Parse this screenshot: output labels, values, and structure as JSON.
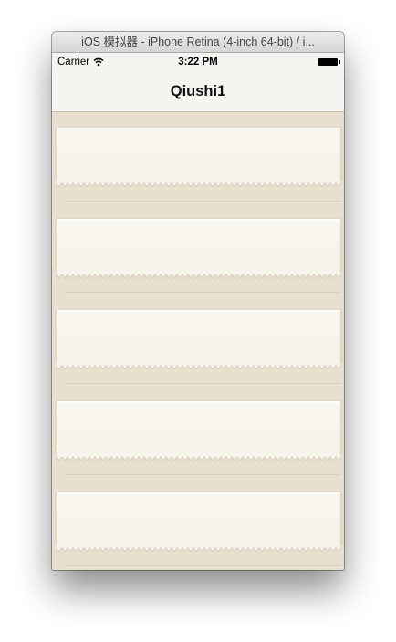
{
  "window": {
    "title": "iOS 模拟器 - iPhone Retina (4-inch 64-bit) / i..."
  },
  "status_bar": {
    "carrier": "Carrier",
    "time": "3:22 PM",
    "wifi_icon": "wifi-icon",
    "battery_icon": "battery-icon"
  },
  "nav_bar": {
    "title": "Qiushi1"
  },
  "table": {
    "cells": [
      {
        "name": "table-cell-1"
      },
      {
        "name": "table-cell-2"
      },
      {
        "name": "table-cell-3"
      },
      {
        "name": "table-cell-4"
      },
      {
        "name": "table-cell-5"
      }
    ]
  },
  "colors": {
    "background": "#e8dfce",
    "card": "#f5f3ea",
    "navbar": "#f6f4f0"
  }
}
